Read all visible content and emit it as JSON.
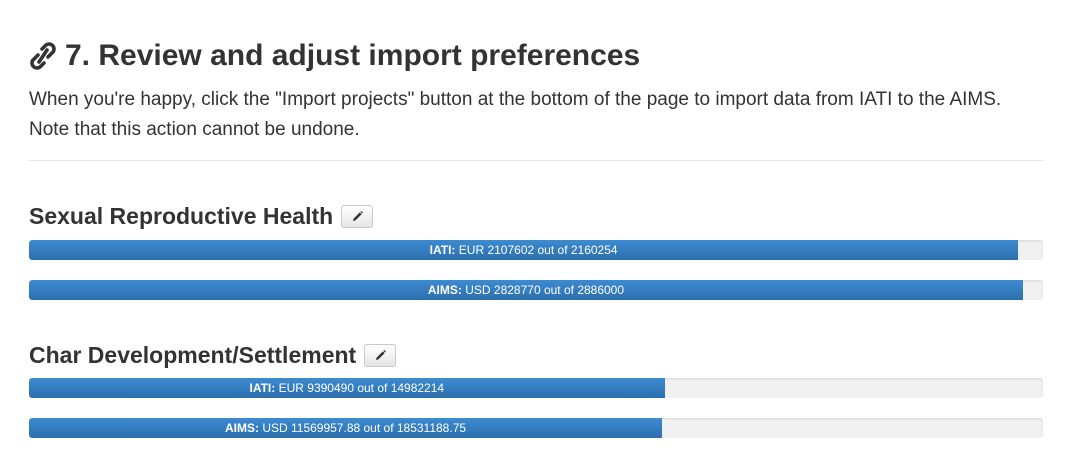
{
  "section": {
    "number_title": "7. Review and adjust import preferences",
    "description": "When you're happy, click the \"Import projects\" button at the bottom of the page to import data from IATI to the AIMS. Note that this action cannot be undone."
  },
  "projects": [
    {
      "title": "Sexual Reproductive Health",
      "bars": [
        {
          "source": "IATI:",
          "text": "EUR 2107602 out of 2160254",
          "fraction": 0.9756
        },
        {
          "source": "AIMS:",
          "text": "USD 2828770 out of 2886000",
          "fraction": 0.9802
        }
      ]
    },
    {
      "title": "Char Development/Settlement",
      "bars": [
        {
          "source": "IATI:",
          "text": "EUR 9390490 out of 14982214",
          "fraction": 0.6268
        },
        {
          "source": "AIMS:",
          "text": "USD 11569957.88 out of 18531188.75",
          "fraction": 0.6243
        }
      ]
    }
  ],
  "colors": {
    "bar_fill": "#3379bd",
    "bar_track": "#f1f1f1",
    "text": "#333333"
  },
  "icons": {
    "section_icon": "link-icon",
    "edit_icon": "pencil-icon"
  }
}
